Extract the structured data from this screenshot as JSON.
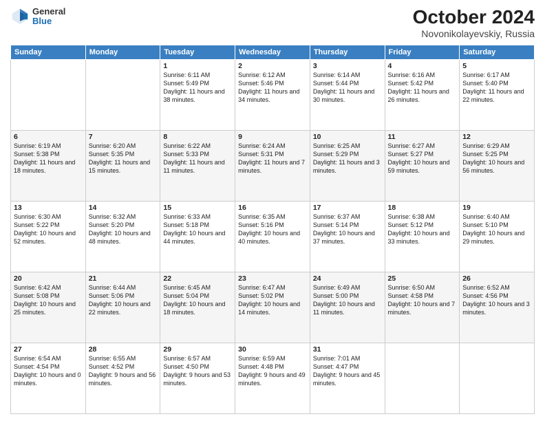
{
  "header": {
    "logo_line1": "General",
    "logo_line2": "Blue",
    "month_title": "October 2024",
    "subtitle": "Novonikolayevskiy, Russia"
  },
  "days_of_week": [
    "Sunday",
    "Monday",
    "Tuesday",
    "Wednesday",
    "Thursday",
    "Friday",
    "Saturday"
  ],
  "weeks": [
    [
      {
        "date": "",
        "sunrise": "",
        "sunset": "",
        "daylight": ""
      },
      {
        "date": "",
        "sunrise": "",
        "sunset": "",
        "daylight": ""
      },
      {
        "date": "1",
        "sunrise": "Sunrise: 6:11 AM",
        "sunset": "Sunset: 5:49 PM",
        "daylight": "Daylight: 11 hours and 38 minutes."
      },
      {
        "date": "2",
        "sunrise": "Sunrise: 6:12 AM",
        "sunset": "Sunset: 5:46 PM",
        "daylight": "Daylight: 11 hours and 34 minutes."
      },
      {
        "date": "3",
        "sunrise": "Sunrise: 6:14 AM",
        "sunset": "Sunset: 5:44 PM",
        "daylight": "Daylight: 11 hours and 30 minutes."
      },
      {
        "date": "4",
        "sunrise": "Sunrise: 6:16 AM",
        "sunset": "Sunset: 5:42 PM",
        "daylight": "Daylight: 11 hours and 26 minutes."
      },
      {
        "date": "5",
        "sunrise": "Sunrise: 6:17 AM",
        "sunset": "Sunset: 5:40 PM",
        "daylight": "Daylight: 11 hours and 22 minutes."
      }
    ],
    [
      {
        "date": "6",
        "sunrise": "Sunrise: 6:19 AM",
        "sunset": "Sunset: 5:38 PM",
        "daylight": "Daylight: 11 hours and 18 minutes."
      },
      {
        "date": "7",
        "sunrise": "Sunrise: 6:20 AM",
        "sunset": "Sunset: 5:35 PM",
        "daylight": "Daylight: 11 hours and 15 minutes."
      },
      {
        "date": "8",
        "sunrise": "Sunrise: 6:22 AM",
        "sunset": "Sunset: 5:33 PM",
        "daylight": "Daylight: 11 hours and 11 minutes."
      },
      {
        "date": "9",
        "sunrise": "Sunrise: 6:24 AM",
        "sunset": "Sunset: 5:31 PM",
        "daylight": "Daylight: 11 hours and 7 minutes."
      },
      {
        "date": "10",
        "sunrise": "Sunrise: 6:25 AM",
        "sunset": "Sunset: 5:29 PM",
        "daylight": "Daylight: 11 hours and 3 minutes."
      },
      {
        "date": "11",
        "sunrise": "Sunrise: 6:27 AM",
        "sunset": "Sunset: 5:27 PM",
        "daylight": "Daylight: 10 hours and 59 minutes."
      },
      {
        "date": "12",
        "sunrise": "Sunrise: 6:29 AM",
        "sunset": "Sunset: 5:25 PM",
        "daylight": "Daylight: 10 hours and 56 minutes."
      }
    ],
    [
      {
        "date": "13",
        "sunrise": "Sunrise: 6:30 AM",
        "sunset": "Sunset: 5:22 PM",
        "daylight": "Daylight: 10 hours and 52 minutes."
      },
      {
        "date": "14",
        "sunrise": "Sunrise: 6:32 AM",
        "sunset": "Sunset: 5:20 PM",
        "daylight": "Daylight: 10 hours and 48 minutes."
      },
      {
        "date": "15",
        "sunrise": "Sunrise: 6:33 AM",
        "sunset": "Sunset: 5:18 PM",
        "daylight": "Daylight: 10 hours and 44 minutes."
      },
      {
        "date": "16",
        "sunrise": "Sunrise: 6:35 AM",
        "sunset": "Sunset: 5:16 PM",
        "daylight": "Daylight: 10 hours and 40 minutes."
      },
      {
        "date": "17",
        "sunrise": "Sunrise: 6:37 AM",
        "sunset": "Sunset: 5:14 PM",
        "daylight": "Daylight: 10 hours and 37 minutes."
      },
      {
        "date": "18",
        "sunrise": "Sunrise: 6:38 AM",
        "sunset": "Sunset: 5:12 PM",
        "daylight": "Daylight: 10 hours and 33 minutes."
      },
      {
        "date": "19",
        "sunrise": "Sunrise: 6:40 AM",
        "sunset": "Sunset: 5:10 PM",
        "daylight": "Daylight: 10 hours and 29 minutes."
      }
    ],
    [
      {
        "date": "20",
        "sunrise": "Sunrise: 6:42 AM",
        "sunset": "Sunset: 5:08 PM",
        "daylight": "Daylight: 10 hours and 25 minutes."
      },
      {
        "date": "21",
        "sunrise": "Sunrise: 6:44 AM",
        "sunset": "Sunset: 5:06 PM",
        "daylight": "Daylight: 10 hours and 22 minutes."
      },
      {
        "date": "22",
        "sunrise": "Sunrise: 6:45 AM",
        "sunset": "Sunset: 5:04 PM",
        "daylight": "Daylight: 10 hours and 18 minutes."
      },
      {
        "date": "23",
        "sunrise": "Sunrise: 6:47 AM",
        "sunset": "Sunset: 5:02 PM",
        "daylight": "Daylight: 10 hours and 14 minutes."
      },
      {
        "date": "24",
        "sunrise": "Sunrise: 6:49 AM",
        "sunset": "Sunset: 5:00 PM",
        "daylight": "Daylight: 10 hours and 11 minutes."
      },
      {
        "date": "25",
        "sunrise": "Sunrise: 6:50 AM",
        "sunset": "Sunset: 4:58 PM",
        "daylight": "Daylight: 10 hours and 7 minutes."
      },
      {
        "date": "26",
        "sunrise": "Sunrise: 6:52 AM",
        "sunset": "Sunset: 4:56 PM",
        "daylight": "Daylight: 10 hours and 3 minutes."
      }
    ],
    [
      {
        "date": "27",
        "sunrise": "Sunrise: 6:54 AM",
        "sunset": "Sunset: 4:54 PM",
        "daylight": "Daylight: 10 hours and 0 minutes."
      },
      {
        "date": "28",
        "sunrise": "Sunrise: 6:55 AM",
        "sunset": "Sunset: 4:52 PM",
        "daylight": "Daylight: 9 hours and 56 minutes."
      },
      {
        "date": "29",
        "sunrise": "Sunrise: 6:57 AM",
        "sunset": "Sunset: 4:50 PM",
        "daylight": "Daylight: 9 hours and 53 minutes."
      },
      {
        "date": "30",
        "sunrise": "Sunrise: 6:59 AM",
        "sunset": "Sunset: 4:48 PM",
        "daylight": "Daylight: 9 hours and 49 minutes."
      },
      {
        "date": "31",
        "sunrise": "Sunrise: 7:01 AM",
        "sunset": "Sunset: 4:47 PM",
        "daylight": "Daylight: 9 hours and 45 minutes."
      },
      {
        "date": "",
        "sunrise": "",
        "sunset": "",
        "daylight": ""
      },
      {
        "date": "",
        "sunrise": "",
        "sunset": "",
        "daylight": ""
      }
    ]
  ]
}
